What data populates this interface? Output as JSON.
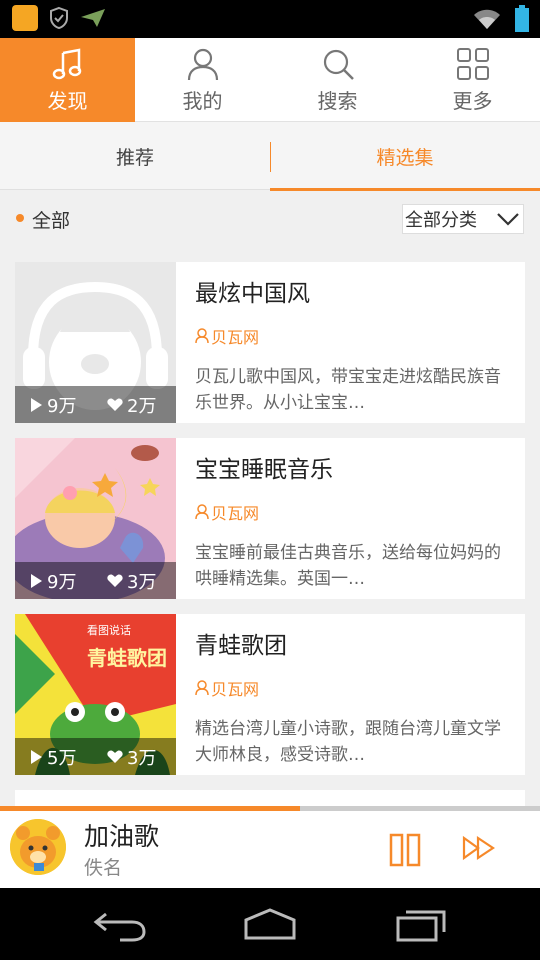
{
  "topnav": {
    "tabs": [
      {
        "label": "发现",
        "icon": "music-note-icon",
        "active": true
      },
      {
        "label": "我的",
        "icon": "user-icon",
        "active": false
      },
      {
        "label": "搜索",
        "icon": "search-icon",
        "active": false
      },
      {
        "label": "更多",
        "icon": "grid-icon",
        "active": false
      }
    ]
  },
  "subtabs": [
    {
      "label": "推荐",
      "active": false
    },
    {
      "label": "精选集",
      "active": true
    }
  ],
  "filter": {
    "all_label": "全部",
    "category_label": "全部分类"
  },
  "cards": [
    {
      "title": "最炫中国风",
      "author": "贝瓦网",
      "plays": "9万",
      "likes": "2万",
      "desc": "贝瓦儿歌中国风，带宝宝走进炫酷民族音乐世界。从小让宝宝…"
    },
    {
      "title": "宝宝睡眠音乐",
      "author": "贝瓦网",
      "plays": "9万",
      "likes": "3万",
      "desc": "宝宝睡前最佳古典音乐，送给每位妈妈的哄睡精选集。英国一…"
    },
    {
      "title": "青蛙歌团",
      "author": "贝瓦网",
      "plays": "5万",
      "likes": "3万",
      "desc": "精选台湾儿童小诗歌，跟随台湾儿童文学大师林良，感受诗歌…",
      "cover_text": "青蛙歌团",
      "cover_subtext": "看图说话"
    }
  ],
  "player": {
    "song": "加油歌",
    "artist": "佚名",
    "progress": 0.556
  },
  "colors": {
    "accent": "#f6892a"
  }
}
